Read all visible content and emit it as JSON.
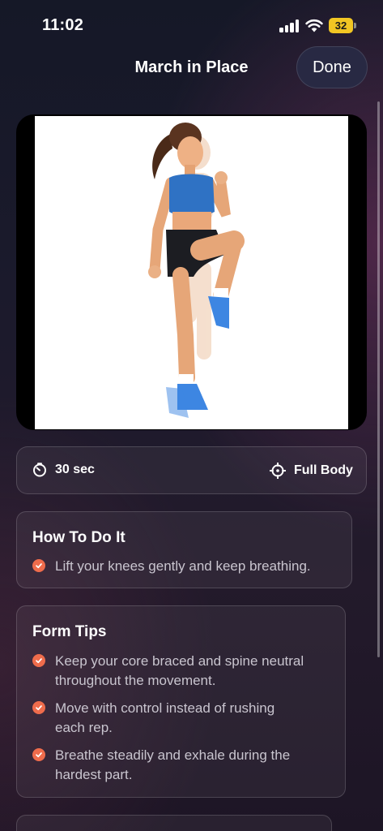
{
  "status_bar": {
    "time": "11:02",
    "battery": "32",
    "battery_color": "#f2c623"
  },
  "header": {
    "title": "March in Place",
    "done_label": "Done"
  },
  "exercise_image": {
    "description_icon": "exercise-illustration"
  },
  "info": {
    "duration": "30 sec",
    "duration_icon": "timer-icon",
    "target": "Full Body",
    "target_icon": "crosshair-icon"
  },
  "how_to": {
    "title": "How To Do It",
    "steps": [
      "Lift your knees gently and keep breathing."
    ]
  },
  "form_tips": {
    "title": "Form Tips",
    "tips": [
      [
        "Keep your core braced and spine neutral",
        "throughout the movement."
      ],
      [
        "Move with control instead of rushing",
        "each rep."
      ],
      [
        "Breathe steadily and exhale during the",
        "hardest part."
      ]
    ]
  },
  "colors": {
    "accent": "#ef6c4c",
    "card_border": "#3a3445"
  }
}
